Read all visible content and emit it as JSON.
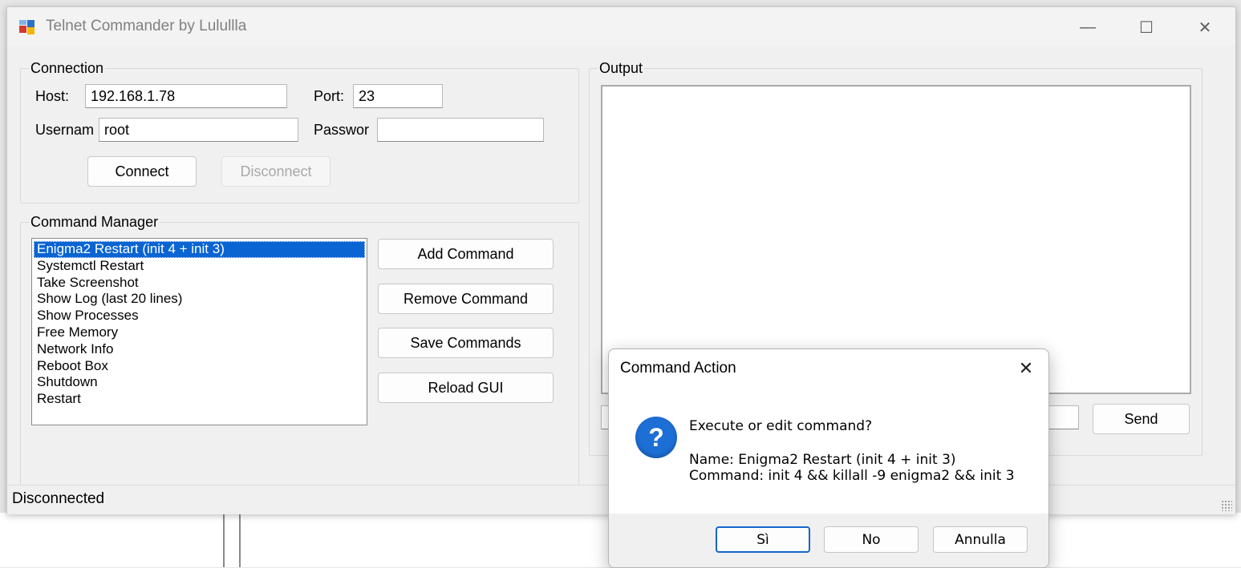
{
  "window": {
    "title": "Telnet Commander by Lulullla",
    "controls": {
      "minimize": "—",
      "maximize": "☐",
      "close": "✕"
    }
  },
  "connection": {
    "group_label": "Connection",
    "host_label": "Host:",
    "host_value": "192.168.1.78",
    "port_label": "Port:",
    "port_value": "23",
    "username_label": "Usernam",
    "username_value": "root",
    "password_label": "Passwor",
    "password_value": "",
    "connect_label": "Connect",
    "disconnect_label": "Disconnect"
  },
  "command_manager": {
    "group_label": "Command Manager",
    "items": [
      "Enigma2 Restart (init 4 + init 3)",
      "Systemctl Restart",
      "Take Screenshot",
      "Show Log (last 20 lines)",
      "Show Processes",
      "Free Memory",
      "Network Info",
      "Reboot Box",
      "Shutdown",
      "Restart"
    ],
    "selected_index": 0,
    "add_label": "Add Command",
    "remove_label": "Remove Command",
    "save_label": "Save Commands",
    "reload_label": "Reload GUI"
  },
  "output": {
    "group_label": "Output",
    "send_label": "Send",
    "command_value": ""
  },
  "status": {
    "text": "Disconnected"
  },
  "dialog": {
    "title": "Command Action",
    "close": "✕",
    "icon": "question-icon",
    "question": "Execute or edit command?",
    "name_line": "Name: Enigma2 Restart (init 4 + init 3)",
    "command_line": "Command: init 4 && killall -9 enigma2 && init 3",
    "yes_label": "Sì",
    "no_label": "No",
    "cancel_label": "Annulla"
  },
  "colors": {
    "selection": "#0a64d2",
    "dialog_icon": "#1d6fd6",
    "default_button_border": "#1366c8"
  }
}
